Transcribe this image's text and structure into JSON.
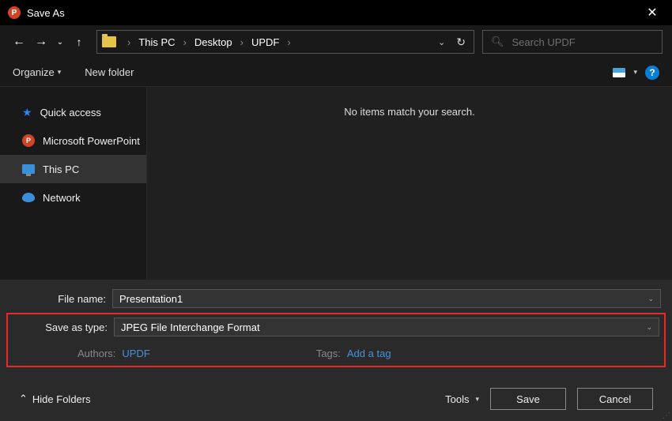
{
  "titlebar": {
    "title": "Save As"
  },
  "nav": {
    "crumbs": [
      "This PC",
      "Desktop",
      "UPDF"
    ]
  },
  "search": {
    "placeholder": "Search UPDF"
  },
  "toolbar": {
    "organize": "Organize",
    "new_folder": "New folder"
  },
  "sidebar": {
    "items": [
      {
        "label": "Quick access"
      },
      {
        "label": "Microsoft PowerPoint"
      },
      {
        "label": "This PC"
      },
      {
        "label": "Network"
      }
    ]
  },
  "content": {
    "empty_message": "No items match your search."
  },
  "fields": {
    "filename_label": "File name:",
    "filename_value": "Presentation1",
    "type_label": "Save as type:",
    "type_value": "JPEG File Interchange Format",
    "authors_label": "Authors:",
    "authors_value": "UPDF",
    "tags_label": "Tags:",
    "tags_value": "Add a tag"
  },
  "footer": {
    "hide_folders": "Hide Folders",
    "tools": "Tools",
    "save": "Save",
    "cancel": "Cancel"
  }
}
